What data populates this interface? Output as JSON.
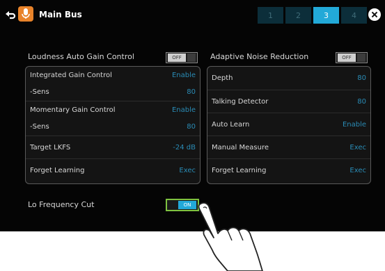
{
  "header": {
    "title": "Main Bus",
    "tabs": [
      "1",
      "2",
      "3",
      "4"
    ],
    "active_tab": "3"
  },
  "left": {
    "heading": "Loudness Auto Gain Control",
    "toggle": "OFF",
    "rows": [
      {
        "label": "Integrated Gain Control",
        "value": "Enable"
      },
      {
        "label": "-Sens",
        "value": "80"
      },
      {
        "label": "Momentary Gain Control",
        "value": "Enable"
      },
      {
        "label": "-Sens",
        "value": "80"
      },
      {
        "label": "Target LKFS",
        "value": "-24 dB"
      },
      {
        "label": "Forget Learning",
        "value": "Exec"
      }
    ]
  },
  "right": {
    "heading": "Adaptive Noise Reduction",
    "toggle": "OFF",
    "rows": [
      {
        "label": "Depth",
        "value": "80"
      },
      {
        "label": "Talking Detector",
        "value": "80"
      },
      {
        "label": "Auto Learn",
        "value": "Enable"
      },
      {
        "label": "Manual Measure",
        "value": "Exec"
      },
      {
        "label": "Forget Learning",
        "value": "Exec"
      }
    ]
  },
  "lo_cut": {
    "label": "Lo Frequency Cut",
    "toggle": "ON"
  },
  "colors": {
    "accent": "#22a9d8",
    "on_border": "#7ec240",
    "mic_badge": "#e8832a"
  }
}
